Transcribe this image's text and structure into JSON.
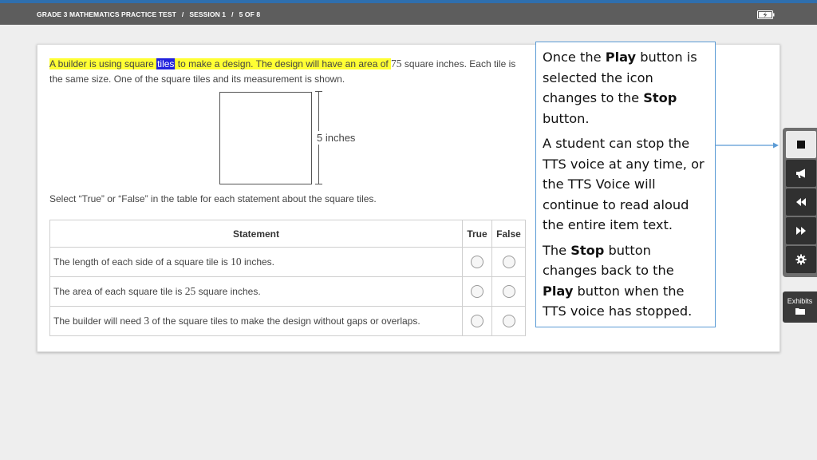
{
  "header": {
    "test_name": "GRADE 3 MATHEMATICS PRACTICE TEST",
    "separator": "/",
    "session": "SESSION 1",
    "progress": "5 OF 8",
    "battery_icon": "battery-charging-icon"
  },
  "item": {
    "prompt_part1": "A builder is using square ",
    "prompt_highlight_word": "tiles",
    "prompt_part2": " to make a design. The design will have an area of ",
    "prompt_area_value": "75",
    "prompt_part3": " square inches. Each tile is the same size. One of the square tiles and its measurement is shown.",
    "figure_label": "5 inches",
    "instruction": "Select “True” or “False” in the table for each statement about the square tiles.",
    "table": {
      "headers": {
        "statement": "Statement",
        "true": "True",
        "false": "False"
      },
      "rows": [
        {
          "pre": "The length of each side of a square tile is ",
          "num": "10",
          "post": " inches."
        },
        {
          "pre": "The area of each square tile is ",
          "num": "25",
          "post": " square inches."
        },
        {
          "pre": "The builder will need ",
          "num": "3",
          "post": " of the square tiles to make the design without gaps or overlaps."
        }
      ]
    }
  },
  "callout": {
    "p1_a": "Once the ",
    "p1_b": "Play",
    "p1_c": " button is selected the icon changes to the ",
    "p1_d": "Stop",
    "p1_e": " button.",
    "p2": "A student can stop the TTS voice at any time, or the TTS Voice will continue to read aloud the entire item text.",
    "p3_a": "The ",
    "p3_b": "Stop",
    "p3_c": " button changes back to the ",
    "p3_d": "Play",
    "p3_e": " button when the TTS voice has stopped."
  },
  "toolbar": {
    "buttons": [
      "stop-icon",
      "megaphone-icon",
      "rewind-icon",
      "fast-forward-icon",
      "gear-icon"
    ],
    "exhibits_label": "Exhibits",
    "exhibits_icon": "folder-icon"
  },
  "colors": {
    "highlight": "#ffff33",
    "tts_word_highlight": "#2222dd",
    "callout_border": "#5b9bd5",
    "top_bar": "#5d5d5d"
  }
}
